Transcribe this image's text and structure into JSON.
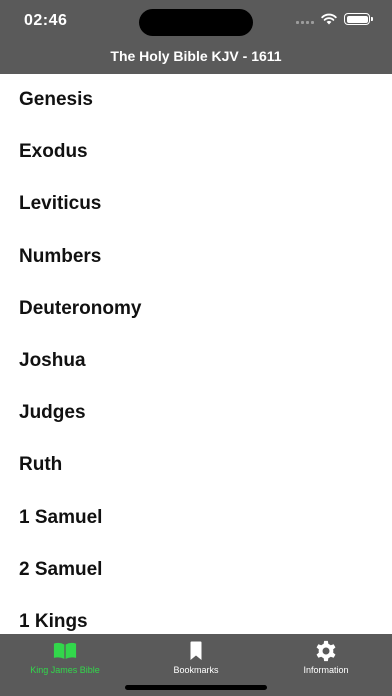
{
  "status_bar": {
    "time": "02:46"
  },
  "nav": {
    "title": "The Holy Bible KJV - 1611"
  },
  "books": [
    "Genesis",
    "Exodus",
    "Leviticus",
    "Numbers",
    "Deuteronomy",
    "Joshua",
    "Judges",
    "Ruth",
    "1 Samuel",
    "2 Samuel",
    "1 Kings"
  ],
  "tabs": [
    {
      "label": "King James Bible",
      "icon": "open-book-icon",
      "active": true
    },
    {
      "label": "Bookmarks",
      "icon": "bookmark-icon",
      "active": false
    },
    {
      "label": "Information",
      "icon": "gear-icon",
      "active": false
    }
  ],
  "colors": {
    "bar": "#5a5a5a",
    "active_tab": "#32d74b",
    "text": "#111111"
  }
}
